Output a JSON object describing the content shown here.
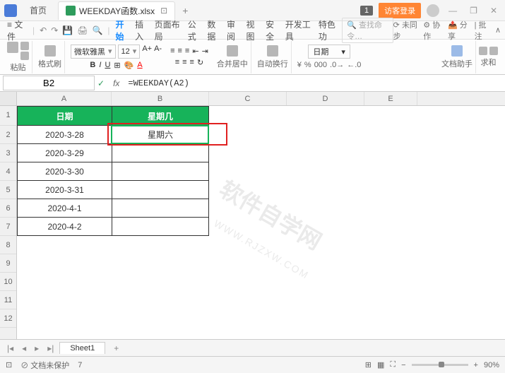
{
  "titlebar": {
    "tab_home": "首页",
    "file_name": "WEEKDAY函数.xlsx",
    "badge": "1",
    "guest_login": "访客登录",
    "min": "—",
    "restore": "❐",
    "close": "✕"
  },
  "menu": {
    "file": "文件",
    "start": "开始",
    "insert": "插入",
    "layout": "页面布局",
    "formula": "公式",
    "data": "数据",
    "review": "审阅",
    "view": "视图",
    "security": "安全",
    "dev": "开发工具",
    "special": "特色功",
    "search_placeholder": "查找命令…",
    "unsync": "未同步",
    "coop": "协作",
    "share": "分享",
    "batch": "批注"
  },
  "ribbon": {
    "paste": "粘贴",
    "format_painter": "格式刷",
    "font_name": "微软雅黑",
    "font_size": "12",
    "merge": "合并居中",
    "wrap": "自动换行",
    "number_format": "日期",
    "doc_helper": "文档助手",
    "sum": "求和"
  },
  "formula_bar": {
    "name_box": "B2",
    "fx_label": "fx",
    "formula": "=WEEKDAY(A2)"
  },
  "grid": {
    "cols": [
      "A",
      "B",
      "C",
      "D",
      "E"
    ],
    "rows": [
      "1",
      "2",
      "3",
      "4",
      "5",
      "6",
      "7",
      "8",
      "9",
      "10",
      "11",
      "12"
    ],
    "header_a": "日期",
    "header_b": "星期几",
    "data": [
      {
        "a": "2020-3-28",
        "b": "星期六"
      },
      {
        "a": "2020-3-29",
        "b": ""
      },
      {
        "a": "2020-3-30",
        "b": ""
      },
      {
        "a": "2020-3-31",
        "b": ""
      },
      {
        "a": "2020-4-1",
        "b": ""
      },
      {
        "a": "2020-4-2",
        "b": ""
      }
    ]
  },
  "sheets": {
    "sheet1": "Sheet1",
    "plus": "+"
  },
  "statusbar": {
    "doc_protect": "文档未保护",
    "count": "7",
    "zoom": "90%"
  },
  "watermark": {
    "main": "软件自学网",
    "sub": "WWW.RJZXW.COM"
  },
  "chart_data": {
    "type": "table",
    "title": "WEEKDAY函数",
    "columns": [
      "日期",
      "星期几"
    ],
    "rows": [
      [
        "2020-3-28",
        "星期六"
      ],
      [
        "2020-3-29",
        ""
      ],
      [
        "2020-3-30",
        ""
      ],
      [
        "2020-3-31",
        ""
      ],
      [
        "2020-4-1",
        ""
      ],
      [
        "2020-4-2",
        ""
      ]
    ],
    "formula_cell": "B2",
    "formula": "=WEEKDAY(A2)"
  }
}
